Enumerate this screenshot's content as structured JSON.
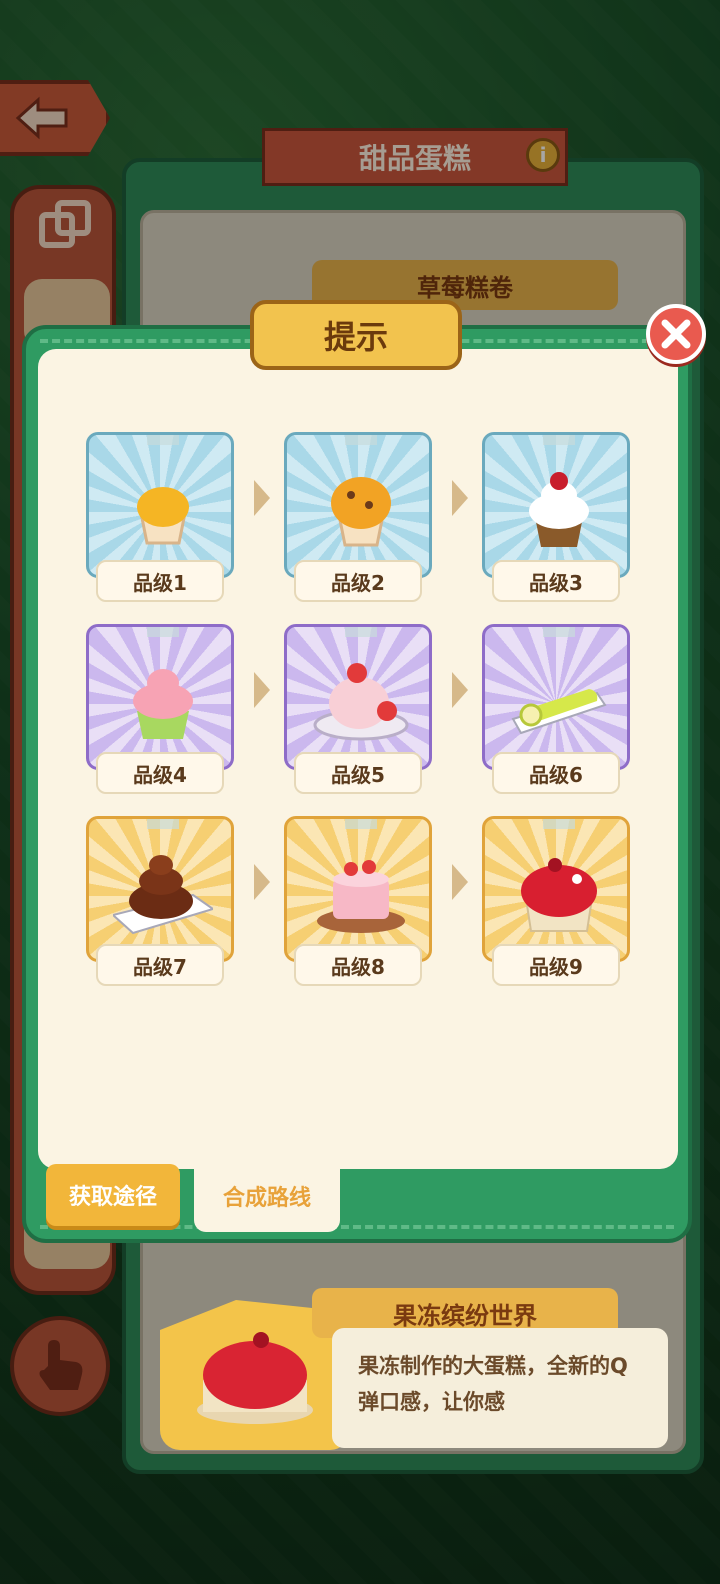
{
  "header": {
    "title": "甜品蛋糕",
    "info_icon": "i"
  },
  "back_panel": {
    "top_label": "草莓糕卷",
    "bottom_label": "果冻缤纷世界",
    "description": "果冻制作的大蛋糕，全新的Q弹口感，让你感"
  },
  "modal": {
    "title": "提示",
    "close_icon": "close-icon",
    "items": [
      {
        "label": "品级1",
        "tier": "blue"
      },
      {
        "label": "品级2",
        "tier": "blue"
      },
      {
        "label": "品级3",
        "tier": "blue"
      },
      {
        "label": "品级4",
        "tier": "purple"
      },
      {
        "label": "品级5",
        "tier": "purple"
      },
      {
        "label": "品级6",
        "tier": "purple"
      },
      {
        "label": "品级7",
        "tier": "gold"
      },
      {
        "label": "品级8",
        "tier": "gold"
      },
      {
        "label": "品级9",
        "tier": "gold"
      }
    ],
    "tabs": {
      "get_way": "获取途径",
      "merge_route": "合成路线"
    }
  },
  "colors": {
    "panel_green": "#2f9b62",
    "cream": "#fbf4e3",
    "gold": "#f2c34e",
    "close_red": "#e95a4f"
  }
}
